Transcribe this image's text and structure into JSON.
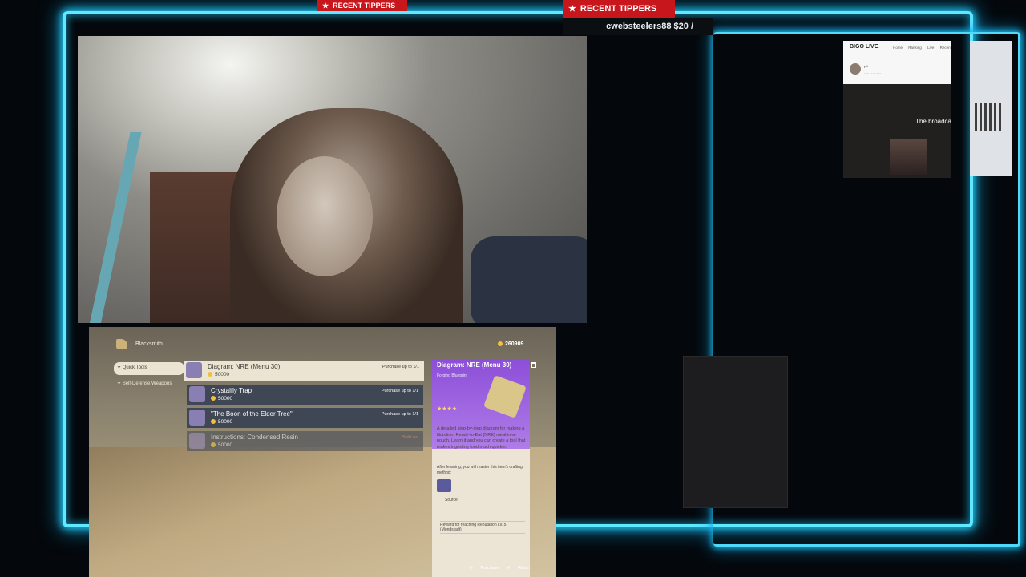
{
  "overlay": {
    "recent_tippers_small": "RECENT TIPPERS",
    "recent_tippers_large": "RECENT TIPPERS",
    "ticker_text": "cwebsteelers88 $20 /"
  },
  "game": {
    "shop_title": "Blacksmith",
    "currency": "260909",
    "categories": [
      {
        "label": "Quick Tools"
      },
      {
        "label": "Self-Defense Weapons"
      }
    ],
    "items": [
      {
        "name": "Diagram: NRE (Menu 30)",
        "cost": "50000",
        "limit": "Purchase up to 1/1"
      },
      {
        "name": "Crystalfly Trap",
        "cost": "50000",
        "limit": "Purchase up to 1/1"
      },
      {
        "name": "\"The Boon of the Elder Tree\"",
        "cost": "50000",
        "limit": "Purchase up to 1/1"
      },
      {
        "name": "Instructions: Condensed Resin",
        "cost": "50000",
        "limit": "Sold out"
      }
    ],
    "detail": {
      "title": "Diagram: NRE (Menu 30)",
      "subtitle": "Forging Blueprint",
      "stars": "★★★★",
      "description": "A detailed step-by-step diagram for making a Nutrition, Ready-to-Eat (NRE) meal-in-a-pouch. Learn it and you can create a tool that makes ingesting food much quicker.",
      "after_learning": "After learning, you will master this item's crafting method:",
      "source_label": "Source",
      "reward": "Reward for reaching Reputation Lv. 5 (Mondstadt)"
    },
    "footer": {
      "left": "Purchase",
      "right": "Return"
    }
  },
  "bigo": {
    "logo": "BIGO LIVE",
    "nav": [
      "Home",
      "Ranking",
      "Live",
      "Recent"
    ],
    "user_name": "Nº· ······",
    "user_sub": "······ ·········",
    "message": "The broadca"
  },
  "colors": {
    "neon": "#5fe8ff",
    "tippers_red": "#c8161d",
    "detail_purple": "#8c4ed8"
  }
}
